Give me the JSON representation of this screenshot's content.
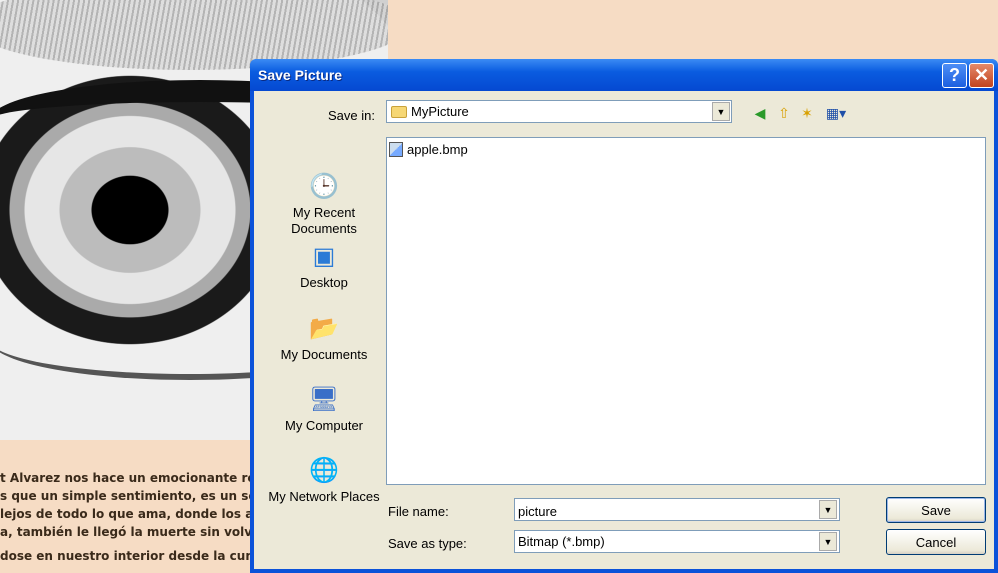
{
  "background": {
    "text_lines": [
      "t Alvarez nos hace un emocionante rela",
      "s que un simple sentimiento, es un sello",
      "lejos de todo lo que ama, donde los año",
      "a, también le llegó la muerte sin volver",
      "dose en nuestro interior desde la cuna."
    ]
  },
  "dialog": {
    "title": "Save Picture",
    "help_glyph": "?",
    "close_glyph": "✕",
    "save_in_label": "Save in:",
    "save_in_value": "MyPicture",
    "places": [
      {
        "label": "My Recent Documents",
        "icon": "recent-documents-icon"
      },
      {
        "label": "Desktop",
        "icon": "desktop-icon"
      },
      {
        "label": "My Documents",
        "icon": "my-documents-icon"
      },
      {
        "label": "My Computer",
        "icon": "my-computer-icon"
      },
      {
        "label": "My Network Places",
        "icon": "network-places-icon"
      }
    ],
    "files": [
      {
        "name": "apple.bmp",
        "icon": "bitmap-file-icon"
      }
    ],
    "file_name_label": "File name:",
    "file_name_value": "picture",
    "save_as_type_label": "Save as type:",
    "save_as_type_value": "Bitmap (*.bmp)",
    "save_button": "Save",
    "cancel_button": "Cancel"
  }
}
